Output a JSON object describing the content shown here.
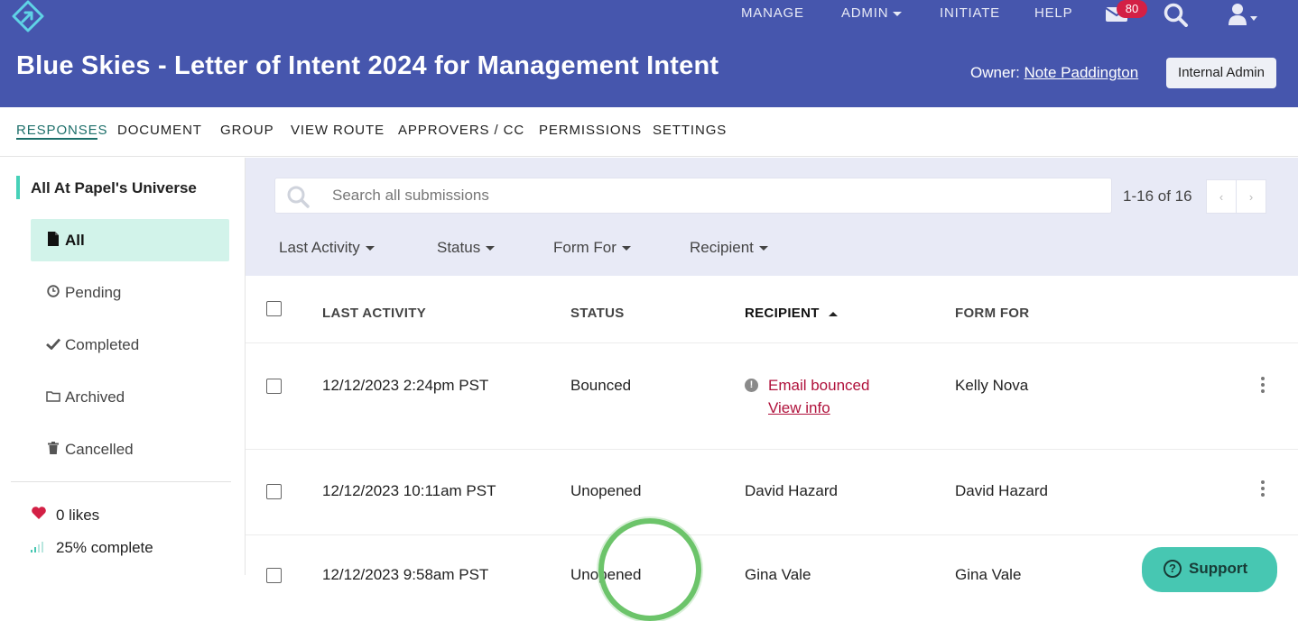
{
  "topnav": {
    "manage": "MANAGE",
    "admin": "ADMIN",
    "initiate": "INITIATE",
    "help": "HELP",
    "mail_count": "80"
  },
  "header": {
    "title": "Blue Skies - Letter of Intent 2024 for Management Intent",
    "owner_label": "Owner:",
    "owner_name": "Note Paddington",
    "role_button": "Internal Admin"
  },
  "tabs": [
    "RESPONSES",
    "DOCUMENT",
    "GROUP",
    "VIEW ROUTE",
    "APPROVERS / CC",
    "PERMISSIONS",
    "SETTINGS"
  ],
  "sidebar": {
    "group_title": "All At Papel's Universe",
    "items": [
      {
        "label": "All",
        "icon": "file-icon",
        "active": true
      },
      {
        "label": "Pending",
        "icon": "clock-icon"
      },
      {
        "label": "Completed",
        "icon": "check-icon"
      },
      {
        "label": "Archived",
        "icon": "folder-icon"
      },
      {
        "label": "Cancelled",
        "icon": "trash-icon"
      }
    ],
    "likes": "0 likes",
    "complete": "25% complete"
  },
  "filters": {
    "search_placeholder": "Search all submissions",
    "range": "1-16 of 16",
    "dropdowns": [
      "Last Activity",
      "Status",
      "Form For",
      "Recipient"
    ]
  },
  "table": {
    "headers": [
      "LAST ACTIVITY",
      "STATUS",
      "RECIPIENT",
      "FORM FOR"
    ],
    "rows": [
      {
        "last_activity": "12/12/2023 2:24pm PST",
        "status": "Bounced",
        "recipient": "Email bounced",
        "recipient_link": "View info",
        "form_for": "Kelly Nova"
      },
      {
        "last_activity": "12/12/2023 10:11am PST",
        "status": "Unopened",
        "recipient": "David Hazard",
        "form_for": "David Hazard"
      },
      {
        "last_activity": "12/12/2023 9:58am PST",
        "status": "Unopened",
        "recipient": "Gina Vale",
        "form_for": "Gina Vale"
      }
    ]
  },
  "support": {
    "label": "Support"
  },
  "colors": {
    "header": "#4656ad",
    "accent": "#1d6f6a",
    "active_bg": "#d2f3ea",
    "error": "#b0123c",
    "support": "#47c7b2"
  }
}
